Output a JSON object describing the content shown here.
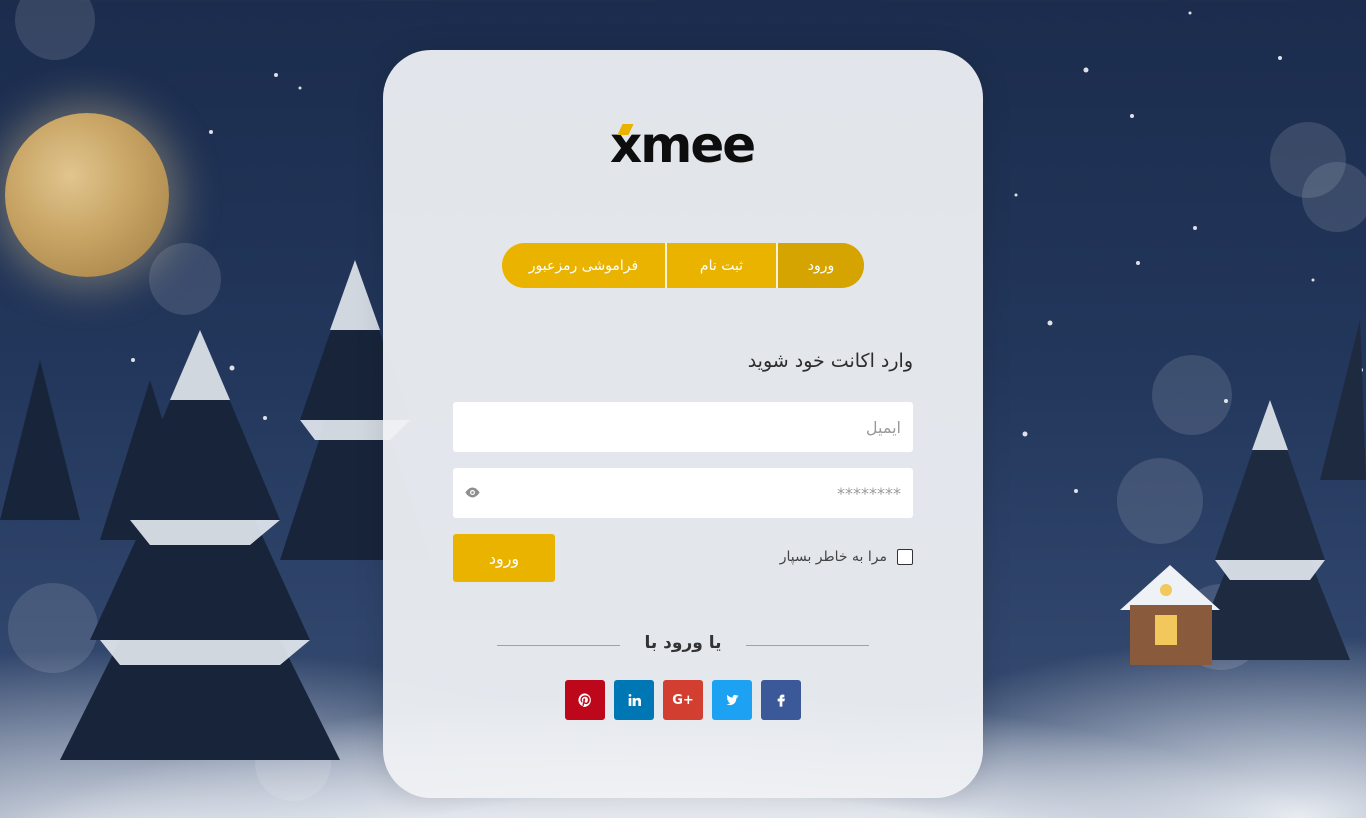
{
  "brand": {
    "logo_text": "xmee",
    "accent_color": "#e9b300"
  },
  "tabs": [
    {
      "label": "ورود",
      "active": true
    },
    {
      "label": "ثبت نام",
      "active": false
    },
    {
      "label": "فراموشی رمزعبور",
      "active": false
    }
  ],
  "form": {
    "title": "وارد اکانت خود شوید",
    "email": {
      "placeholder": "ایمیل",
      "value": ""
    },
    "password": {
      "placeholder": "********",
      "value": ""
    },
    "remember_label": "مرا به خاطر بسپار",
    "remember_checked": false,
    "submit_label": "ورود"
  },
  "social": {
    "divider_text": "یا ورود با",
    "buttons": [
      {
        "name": "facebook",
        "icon": "facebook-icon",
        "color": "#3b5998"
      },
      {
        "name": "twitter",
        "icon": "twitter-icon",
        "color": "#1da1f2"
      },
      {
        "name": "google-plus",
        "icon": "google-plus-icon",
        "color": "#d23f31"
      },
      {
        "name": "linkedin",
        "icon": "linkedin-icon",
        "color": "#0077b5"
      },
      {
        "name": "pinterest",
        "icon": "pinterest-icon",
        "color": "#bd081c"
      }
    ]
  }
}
